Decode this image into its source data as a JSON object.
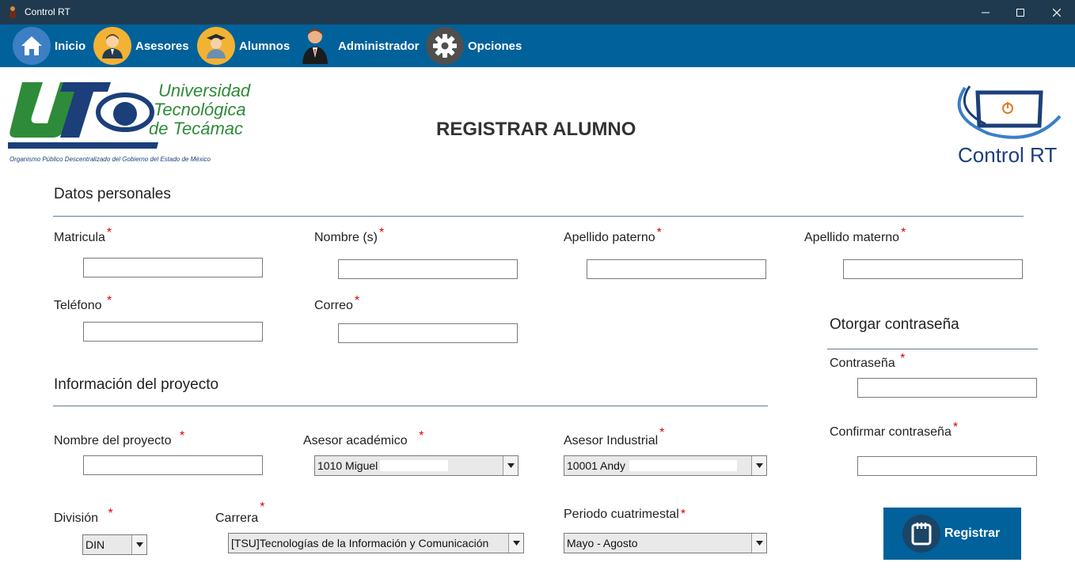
{
  "window": {
    "title": "Control RT"
  },
  "nav": {
    "items": [
      {
        "label": "Inicio",
        "icon": "home-icon"
      },
      {
        "label": "Asesores",
        "icon": "advisor-icon"
      },
      {
        "label": "Alumnos",
        "icon": "student-icon"
      },
      {
        "label": "Administrador",
        "icon": "admin-icon"
      },
      {
        "label": "Opciones",
        "icon": "gear-icon"
      }
    ]
  },
  "logo_left": {
    "line1": "Universidad",
    "line2": "Tecnológica",
    "line3": "de Tecámac",
    "tagline": "Organismo Público Descentralizado del Gobierno del Estado de México"
  },
  "logo_right": {
    "text": "Control RT"
  },
  "page": {
    "heading": "REGISTRAR ALUMNO"
  },
  "personal": {
    "title": "Datos personales",
    "matricula": "Matricula",
    "nombre": "Nombre (s)",
    "apellido_paterno": "Apellido paterno",
    "apellido_materno": "Apellido materno",
    "telefono": "Teléfono",
    "correo": "Correo"
  },
  "password": {
    "title": "Otorgar contraseña",
    "contrasena": "Contraseña",
    "confirmar": "Confirmar contraseña"
  },
  "project": {
    "title": "Información del proyecto",
    "nombre_proyecto": "Nombre del proyecto",
    "asesor_academico": "Asesor académico",
    "asesor_academico_value": "1010 Miguel",
    "asesor_industrial": "Asesor Industrial",
    "asesor_industrial_value": "10001 Andy",
    "division": "División",
    "division_value": "DIN",
    "carrera": "Carrera",
    "carrera_value": "[TSU]Tecnologías de la Información y Comunicación",
    "periodo": "Periodo cuatrimestal",
    "periodo_value": "Mayo - Agosto"
  },
  "required_mark": "*",
  "register_button": {
    "label": "Registrar"
  },
  "colors": {
    "nav": "#00619b",
    "titlebar": "#1f3a4f",
    "utt_green": "#2e8b3a",
    "utt_blue": "#1c3f7a",
    "required": "#dd0000"
  }
}
